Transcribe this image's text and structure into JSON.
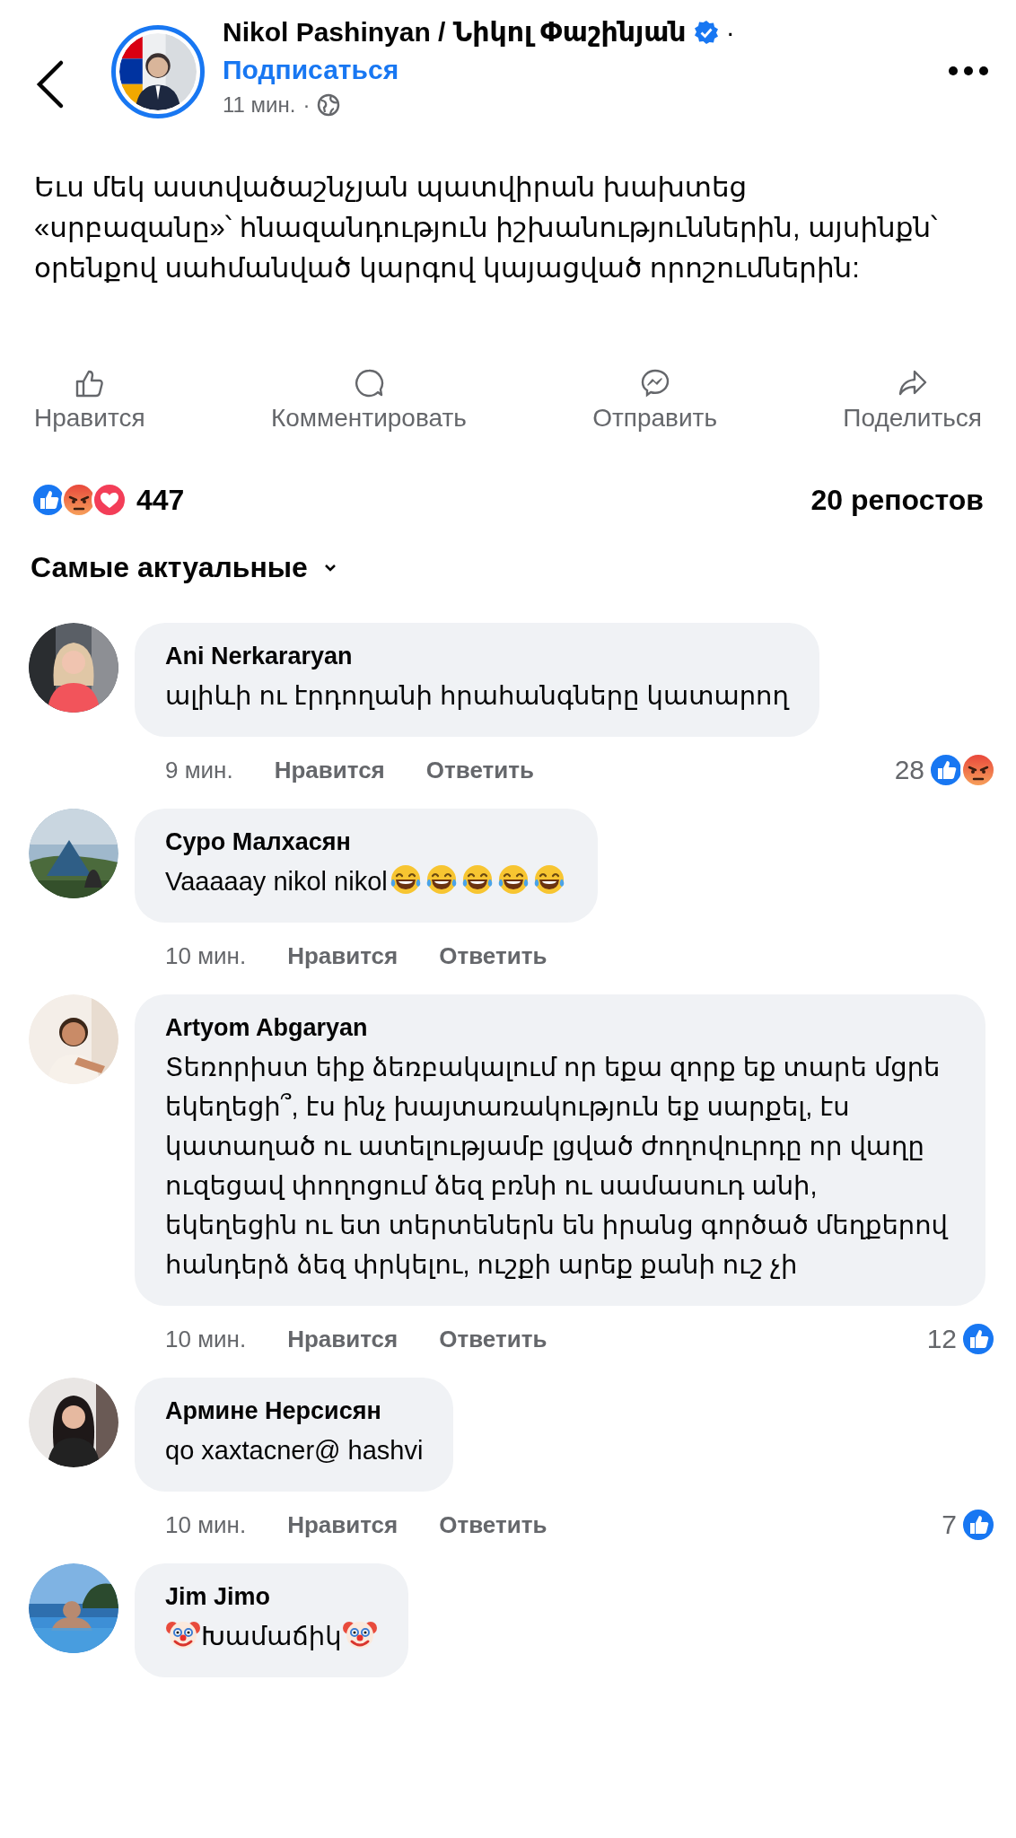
{
  "header": {
    "author": "Nikol Pashinyan / Նիկոլ Փաշինյան",
    "verified": true,
    "name_separator": "·",
    "follow": "Подписаться",
    "time": "11 мин.",
    "time_separator": "·",
    "avatar": {
      "kind": "picture"
    }
  },
  "post": {
    "text": "Եւս մեկ աստվածաշնչյան պատվիրան խախտեց «սրբազանը»՝ հնազանդություն իշխանություններին, այսինքն՝ օրենքով սահմանված կարգով կայացված որոշումներին:"
  },
  "actions": [
    {
      "kind": "like",
      "label": "Нравится"
    },
    {
      "kind": "comment",
      "label": "Комментировать"
    },
    {
      "kind": "send",
      "label": "Отправить"
    },
    {
      "kind": "share",
      "label": "Поделиться"
    }
  ],
  "stats": {
    "reactions": [
      {
        "kind": "like"
      },
      {
        "kind": "angry"
      },
      {
        "kind": "love"
      }
    ],
    "count": "447",
    "shares": "20 репостов"
  },
  "sort": {
    "label": "Самые актуальные"
  },
  "comments": [
    {
      "author": "Ani Nerkararyan",
      "avatar": {
        "kind": "picture"
      },
      "body": [
        {
          "kind": "text",
          "text": "ալիևի ու էրդողանի հրահանգները կատարող"
        }
      ],
      "meta": {
        "time": "9 мин.",
        "like": "Нравится",
        "reply": "Ответить",
        "count": "28",
        "reactions": [
          {
            "kind": "like"
          },
          {
            "kind": "angry"
          }
        ]
      }
    },
    {
      "author": "Суро Малхасян",
      "avatar": {
        "kind": "picture"
      },
      "body": [
        {
          "kind": "text",
          "text": "Vaaaaay nikol nikol"
        },
        {
          "kind": "laugh"
        },
        {
          "kind": "laugh"
        },
        {
          "kind": "laugh"
        },
        {
          "kind": "laugh"
        },
        {
          "kind": "laugh"
        }
      ],
      "meta": {
        "time": "10 мин.",
        "like": "Нравится",
        "reply": "Ответить"
      }
    },
    {
      "author": "Artyom Abgaryan",
      "avatar": {
        "kind": "picture"
      },
      "body": [
        {
          "kind": "text",
          "text": "Տեռորիստ եիք ձեռբակալում որ եքա զորք եք տարե մցրե եկեղեցի՞, էս ինչ խայտառակություն եք սարքել, էս կատաղած ու ատելությամբ լցված ժողովուրդը որ վաղը ուզեցավ փողոցում ձեզ բռնի ու սամասուդ անի, եկեղեցին ու ետ տերտեներն են իրանց գործած մեղքերով հանդերձ ձեզ փրկելու, ուշքի արեք քանի ուշ չի"
        }
      ],
      "meta": {
        "time": "10 мин.",
        "like": "Нравится",
        "reply": "Ответить",
        "count": "12",
        "reactions": [
          {
            "kind": "like"
          }
        ]
      }
    },
    {
      "author": "Армине Нерсисян",
      "avatar": {
        "kind": "picture"
      },
      "body": [
        {
          "kind": "text",
          "text": "qo xaxtacner@ hashvi"
        }
      ],
      "meta": {
        "time": "10 мин.",
        "like": "Нравится",
        "reply": "Ответить",
        "count": "7",
        "reactions": [
          {
            "kind": "like"
          }
        ]
      }
    },
    {
      "author": "Jim Jimo",
      "avatar": {
        "kind": "picture"
      },
      "body": [
        {
          "kind": "clown"
        },
        {
          "kind": "text",
          "text": "Խամաճիկ"
        },
        {
          "kind": "clown"
        }
      ]
    }
  ]
}
